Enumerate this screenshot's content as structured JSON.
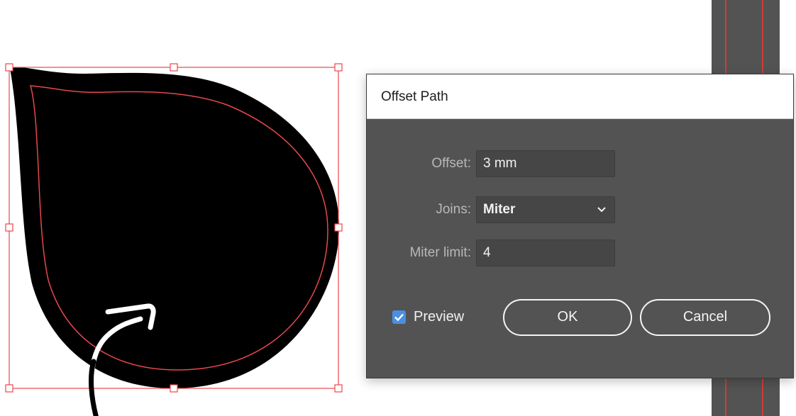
{
  "dialog": {
    "title": "Offset Path",
    "offset_label": "Offset:",
    "offset_value": "3 mm",
    "joins_label": "Joins:",
    "joins_value": "Miter",
    "miter_limit_label": "Miter limit:",
    "miter_limit_value": "4",
    "preview_label": "Preview",
    "preview_checked": true,
    "ok_label": "OK",
    "cancel_label": "Cancel"
  },
  "icons": {
    "checkbox": "checkmark-icon",
    "joins_dropdown": "chevron-down-icon",
    "annotation": "curved-arrow-icon"
  },
  "colors": {
    "dialog_bg": "#535353",
    "field_bg": "#464646",
    "selection": "#e8474c",
    "accent": "#4a90e2",
    "shape_fill": "#000000"
  }
}
